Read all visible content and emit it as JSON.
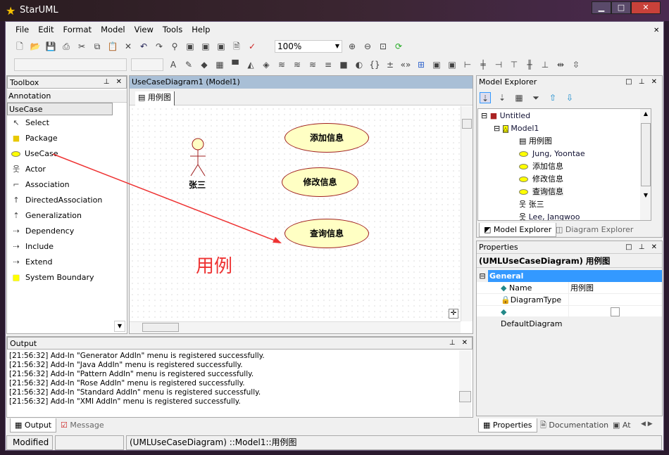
{
  "app": {
    "title": "StarUML"
  },
  "menu": [
    "File",
    "Edit",
    "Format",
    "Model",
    "View",
    "Tools",
    "Help"
  ],
  "toolbar": {
    "zoom": "100%"
  },
  "toolbox": {
    "title": "Toolbox",
    "sections": [
      "Annotation",
      "UseCase"
    ],
    "items": [
      "Select",
      "Package",
      "UseCase",
      "Actor",
      "Association",
      "DirectedAssociation",
      "Generalization",
      "Dependency",
      "Include",
      "Extend",
      "System Boundary"
    ]
  },
  "diagram": {
    "window_title": "UseCaseDiagram1 (Model1)",
    "tab": "用例图",
    "usecases": [
      "添加信息",
      "修改信息",
      "查询信息"
    ],
    "actor": "张三",
    "annotation": "用例",
    "annotation_color": "#ee3333"
  },
  "output": {
    "title": "Output",
    "lines": [
      "[21:56:32]  Add-In \"Generator AddIn\" menu is registered successfully.",
      "[21:56:32]  Add-In \"Java AddIn\" menu is registered successfully.",
      "[21:56:32]  Add-In \"Pattern AddIn\" menu is registered successfully.",
      "[21:56:32]  Add-In \"Rose AddIn\" menu is registered successfully.",
      "[21:56:32]  Add-In \"Standard AddIn\" menu is registered successfully.",
      "[21:56:32]  Add-In \"XMI AddIn\" menu is registered successfully."
    ],
    "tabs": [
      "Output",
      "Message"
    ]
  },
  "explorer": {
    "title": "Model Explorer",
    "root": "Untitled",
    "model": "Model1",
    "children": [
      "用例图",
      "Jung, Yoontae",
      "添加信息",
      "修改信息",
      "查询信息",
      "张三",
      "Lee, Jangwoo"
    ],
    "tabs": [
      "Model Explorer",
      "Diagram Explorer"
    ]
  },
  "properties": {
    "title": "Properties",
    "heading": "(UMLUseCaseDiagram) 用例图",
    "group": "General",
    "rows": [
      {
        "name": "Name",
        "value": "用例图"
      },
      {
        "name": "DiagramType",
        "value": ""
      },
      {
        "name": "DefaultDiagram",
        "value": ""
      }
    ],
    "default_diagram_checked": false,
    "tabs": [
      "Properties",
      "Documentation",
      "At"
    ],
    "accent": "#3399ff"
  },
  "status": {
    "state": "Modified",
    "path": "(UMLUseCaseDiagram) ::Model1::用例图"
  }
}
